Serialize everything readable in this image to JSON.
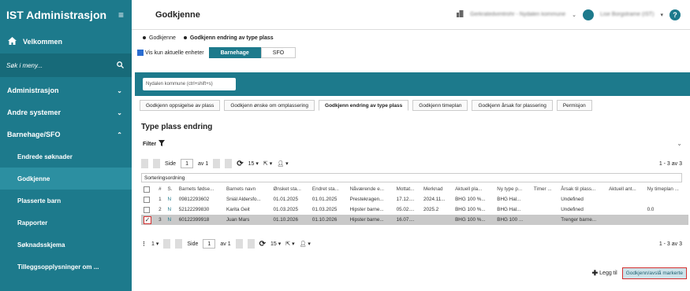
{
  "sidebar": {
    "app_title": "IST Administrasjon",
    "welcome": "Velkommen",
    "search_placeholder": "Søk i meny...",
    "items": [
      {
        "label": "Administrasjon"
      },
      {
        "label": "Andre systemer"
      },
      {
        "label": "Barnehage/SFO"
      }
    ],
    "subitems": [
      {
        "label": "Endrede søknader"
      },
      {
        "label": "Godkjenne"
      },
      {
        "label": "Plasserte barn"
      },
      {
        "label": "Rapporter"
      },
      {
        "label": "Søknadsskjema"
      },
      {
        "label": "Tilleggsopplysninger om ..."
      }
    ]
  },
  "topbar": {
    "title": "Godkjenne",
    "org": "Gerkratedvimtrohr - Nydalen kommune",
    "user": "Lise Borgstrame (IST)",
    "help": "?"
  },
  "breadcrumb": {
    "first": "Godkjenne",
    "second": "Godkjenn endring av type plass"
  },
  "filter": {
    "only_current": "Vis kun aktuelle enheter",
    "tab_barnehage": "Barnehage",
    "tab_sfo": "SFO",
    "municipality_input": "Nydalen kommune (ctrl+shift+s)"
  },
  "tabs": [
    "Godkjenn oppsigelse av plass",
    "Godkjenn ønske om omplassering",
    "Godkjenn endring av type plass",
    "Godkjenn timeplan",
    "Godkjenn årsak for plassering",
    "Permisjon"
  ],
  "section_title": "Type plass endring",
  "filter_label": "Filter",
  "pager": {
    "side_label": "Side",
    "page": "1",
    "of": "av 1",
    "page_size": "15",
    "count": "1 - 3 av 3"
  },
  "sort_label": "Sorteringsordning",
  "table": {
    "headers": [
      "#",
      "S.",
      "Barnets fødse...",
      "Barnets navn",
      "Ønsket sta...",
      "Endret sta...",
      "Nåværende e...",
      "Mottat...",
      "Merknad",
      "Aktuell pla...",
      "Ny type p...",
      "Timer ...",
      "Årsak til plass...",
      "Aktuell ant...",
      "Ny timeplan ..."
    ],
    "rows": [
      [
        "1",
        "N",
        "09812293602",
        "Sniál Aldersfo...",
        "01.01.2025",
        "01.01.2025",
        "Prestekragen...",
        "17.12....",
        "2024.11...",
        "BHG 100 %...",
        "BHG Hal...",
        "",
        "Undefined",
        "",
        ""
      ],
      [
        "2",
        "N",
        "52122299830",
        "Karita Geit",
        "01.03.2025",
        "01.03.2025",
        "Hipster barne...",
        "05.02....",
        "2025.2",
        "BHG 100 %...",
        "BHG Hal...",
        "",
        "Undefined",
        "",
        "0.0"
      ],
      [
        "3",
        "N",
        "60122399918",
        "Juan Mars",
        "01.10.2026",
        "01.10.2026",
        "Hipster barne...",
        "16.07....",
        "",
        "BHG 100 %...",
        "BHG 100 ...",
        "",
        "Trenger barne...",
        "",
        ""
      ]
    ]
  },
  "bottom": {
    "add_label": "Legg til",
    "approve_label": "Godkjenn/avslå markerte"
  },
  "colors": {
    "primary": "#1d7a8c",
    "highlight": "#d32f2f"
  }
}
